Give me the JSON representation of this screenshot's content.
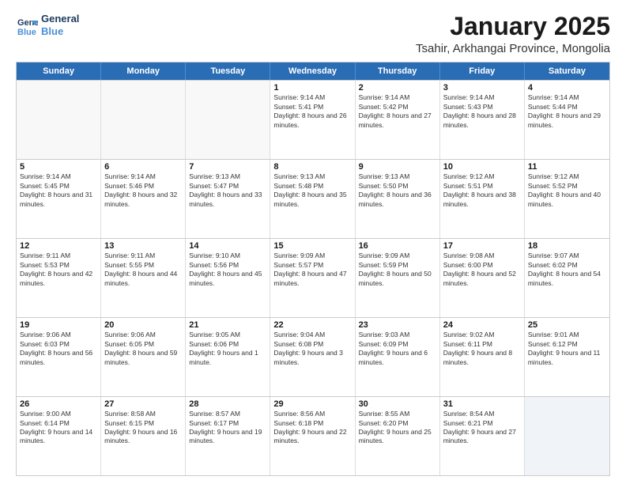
{
  "logo": {
    "line1": "General",
    "line2": "Blue"
  },
  "header": {
    "title": "January 2025",
    "subtitle": "Tsahir, Arkhangai Province, Mongolia"
  },
  "calendar": {
    "days_of_week": [
      "Sunday",
      "Monday",
      "Tuesday",
      "Wednesday",
      "Thursday",
      "Friday",
      "Saturday"
    ],
    "weeks": [
      [
        {
          "day": "",
          "content": ""
        },
        {
          "day": "",
          "content": ""
        },
        {
          "day": "",
          "content": ""
        },
        {
          "day": "1",
          "content": "Sunrise: 9:14 AM\nSunset: 5:41 PM\nDaylight: 8 hours and 26 minutes."
        },
        {
          "day": "2",
          "content": "Sunrise: 9:14 AM\nSunset: 5:42 PM\nDaylight: 8 hours and 27 minutes."
        },
        {
          "day": "3",
          "content": "Sunrise: 9:14 AM\nSunset: 5:43 PM\nDaylight: 8 hours and 28 minutes."
        },
        {
          "day": "4",
          "content": "Sunrise: 9:14 AM\nSunset: 5:44 PM\nDaylight: 8 hours and 29 minutes."
        }
      ],
      [
        {
          "day": "5",
          "content": "Sunrise: 9:14 AM\nSunset: 5:45 PM\nDaylight: 8 hours and 31 minutes."
        },
        {
          "day": "6",
          "content": "Sunrise: 9:14 AM\nSunset: 5:46 PM\nDaylight: 8 hours and 32 minutes."
        },
        {
          "day": "7",
          "content": "Sunrise: 9:13 AM\nSunset: 5:47 PM\nDaylight: 8 hours and 33 minutes."
        },
        {
          "day": "8",
          "content": "Sunrise: 9:13 AM\nSunset: 5:48 PM\nDaylight: 8 hours and 35 minutes."
        },
        {
          "day": "9",
          "content": "Sunrise: 9:13 AM\nSunset: 5:50 PM\nDaylight: 8 hours and 36 minutes."
        },
        {
          "day": "10",
          "content": "Sunrise: 9:12 AM\nSunset: 5:51 PM\nDaylight: 8 hours and 38 minutes."
        },
        {
          "day": "11",
          "content": "Sunrise: 9:12 AM\nSunset: 5:52 PM\nDaylight: 8 hours and 40 minutes."
        }
      ],
      [
        {
          "day": "12",
          "content": "Sunrise: 9:11 AM\nSunset: 5:53 PM\nDaylight: 8 hours and 42 minutes."
        },
        {
          "day": "13",
          "content": "Sunrise: 9:11 AM\nSunset: 5:55 PM\nDaylight: 8 hours and 44 minutes."
        },
        {
          "day": "14",
          "content": "Sunrise: 9:10 AM\nSunset: 5:56 PM\nDaylight: 8 hours and 45 minutes."
        },
        {
          "day": "15",
          "content": "Sunrise: 9:09 AM\nSunset: 5:57 PM\nDaylight: 8 hours and 47 minutes."
        },
        {
          "day": "16",
          "content": "Sunrise: 9:09 AM\nSunset: 5:59 PM\nDaylight: 8 hours and 50 minutes."
        },
        {
          "day": "17",
          "content": "Sunrise: 9:08 AM\nSunset: 6:00 PM\nDaylight: 8 hours and 52 minutes."
        },
        {
          "day": "18",
          "content": "Sunrise: 9:07 AM\nSunset: 6:02 PM\nDaylight: 8 hours and 54 minutes."
        }
      ],
      [
        {
          "day": "19",
          "content": "Sunrise: 9:06 AM\nSunset: 6:03 PM\nDaylight: 8 hours and 56 minutes."
        },
        {
          "day": "20",
          "content": "Sunrise: 9:06 AM\nSunset: 6:05 PM\nDaylight: 8 hours and 59 minutes."
        },
        {
          "day": "21",
          "content": "Sunrise: 9:05 AM\nSunset: 6:06 PM\nDaylight: 9 hours and 1 minute."
        },
        {
          "day": "22",
          "content": "Sunrise: 9:04 AM\nSunset: 6:08 PM\nDaylight: 9 hours and 3 minutes."
        },
        {
          "day": "23",
          "content": "Sunrise: 9:03 AM\nSunset: 6:09 PM\nDaylight: 9 hours and 6 minutes."
        },
        {
          "day": "24",
          "content": "Sunrise: 9:02 AM\nSunset: 6:11 PM\nDaylight: 9 hours and 8 minutes."
        },
        {
          "day": "25",
          "content": "Sunrise: 9:01 AM\nSunset: 6:12 PM\nDaylight: 9 hours and 11 minutes."
        }
      ],
      [
        {
          "day": "26",
          "content": "Sunrise: 9:00 AM\nSunset: 6:14 PM\nDaylight: 9 hours and 14 minutes."
        },
        {
          "day": "27",
          "content": "Sunrise: 8:58 AM\nSunset: 6:15 PM\nDaylight: 9 hours and 16 minutes."
        },
        {
          "day": "28",
          "content": "Sunrise: 8:57 AM\nSunset: 6:17 PM\nDaylight: 9 hours and 19 minutes."
        },
        {
          "day": "29",
          "content": "Sunrise: 8:56 AM\nSunset: 6:18 PM\nDaylight: 9 hours and 22 minutes."
        },
        {
          "day": "30",
          "content": "Sunrise: 8:55 AM\nSunset: 6:20 PM\nDaylight: 9 hours and 25 minutes."
        },
        {
          "day": "31",
          "content": "Sunrise: 8:54 AM\nSunset: 6:21 PM\nDaylight: 9 hours and 27 minutes."
        },
        {
          "day": "",
          "content": ""
        }
      ]
    ]
  }
}
